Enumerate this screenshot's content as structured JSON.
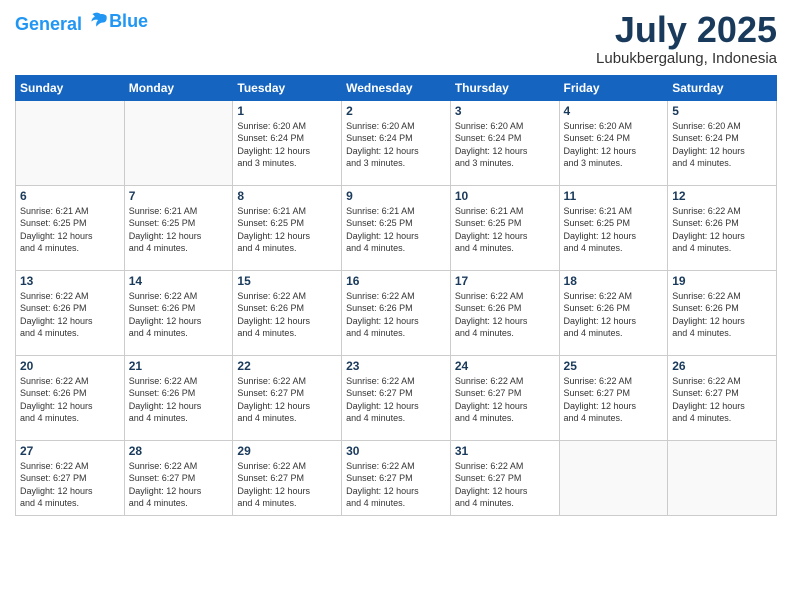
{
  "header": {
    "logo_line1": "General",
    "logo_line2": "Blue",
    "month": "July 2025",
    "location": "Lubukbergalung, Indonesia"
  },
  "weekdays": [
    "Sunday",
    "Monday",
    "Tuesday",
    "Wednesday",
    "Thursday",
    "Friday",
    "Saturday"
  ],
  "weeks": [
    [
      {
        "day": "",
        "info": ""
      },
      {
        "day": "",
        "info": ""
      },
      {
        "day": "1",
        "info": "Sunrise: 6:20 AM\nSunset: 6:24 PM\nDaylight: 12 hours\nand 3 minutes."
      },
      {
        "day": "2",
        "info": "Sunrise: 6:20 AM\nSunset: 6:24 PM\nDaylight: 12 hours\nand 3 minutes."
      },
      {
        "day": "3",
        "info": "Sunrise: 6:20 AM\nSunset: 6:24 PM\nDaylight: 12 hours\nand 3 minutes."
      },
      {
        "day": "4",
        "info": "Sunrise: 6:20 AM\nSunset: 6:24 PM\nDaylight: 12 hours\nand 3 minutes."
      },
      {
        "day": "5",
        "info": "Sunrise: 6:20 AM\nSunset: 6:24 PM\nDaylight: 12 hours\nand 4 minutes."
      }
    ],
    [
      {
        "day": "6",
        "info": "Sunrise: 6:21 AM\nSunset: 6:25 PM\nDaylight: 12 hours\nand 4 minutes."
      },
      {
        "day": "7",
        "info": "Sunrise: 6:21 AM\nSunset: 6:25 PM\nDaylight: 12 hours\nand 4 minutes."
      },
      {
        "day": "8",
        "info": "Sunrise: 6:21 AM\nSunset: 6:25 PM\nDaylight: 12 hours\nand 4 minutes."
      },
      {
        "day": "9",
        "info": "Sunrise: 6:21 AM\nSunset: 6:25 PM\nDaylight: 12 hours\nand 4 minutes."
      },
      {
        "day": "10",
        "info": "Sunrise: 6:21 AM\nSunset: 6:25 PM\nDaylight: 12 hours\nand 4 minutes."
      },
      {
        "day": "11",
        "info": "Sunrise: 6:21 AM\nSunset: 6:25 PM\nDaylight: 12 hours\nand 4 minutes."
      },
      {
        "day": "12",
        "info": "Sunrise: 6:22 AM\nSunset: 6:26 PM\nDaylight: 12 hours\nand 4 minutes."
      }
    ],
    [
      {
        "day": "13",
        "info": "Sunrise: 6:22 AM\nSunset: 6:26 PM\nDaylight: 12 hours\nand 4 minutes."
      },
      {
        "day": "14",
        "info": "Sunrise: 6:22 AM\nSunset: 6:26 PM\nDaylight: 12 hours\nand 4 minutes."
      },
      {
        "day": "15",
        "info": "Sunrise: 6:22 AM\nSunset: 6:26 PM\nDaylight: 12 hours\nand 4 minutes."
      },
      {
        "day": "16",
        "info": "Sunrise: 6:22 AM\nSunset: 6:26 PM\nDaylight: 12 hours\nand 4 minutes."
      },
      {
        "day": "17",
        "info": "Sunrise: 6:22 AM\nSunset: 6:26 PM\nDaylight: 12 hours\nand 4 minutes."
      },
      {
        "day": "18",
        "info": "Sunrise: 6:22 AM\nSunset: 6:26 PM\nDaylight: 12 hours\nand 4 minutes."
      },
      {
        "day": "19",
        "info": "Sunrise: 6:22 AM\nSunset: 6:26 PM\nDaylight: 12 hours\nand 4 minutes."
      }
    ],
    [
      {
        "day": "20",
        "info": "Sunrise: 6:22 AM\nSunset: 6:26 PM\nDaylight: 12 hours\nand 4 minutes."
      },
      {
        "day": "21",
        "info": "Sunrise: 6:22 AM\nSunset: 6:26 PM\nDaylight: 12 hours\nand 4 minutes."
      },
      {
        "day": "22",
        "info": "Sunrise: 6:22 AM\nSunset: 6:27 PM\nDaylight: 12 hours\nand 4 minutes."
      },
      {
        "day": "23",
        "info": "Sunrise: 6:22 AM\nSunset: 6:27 PM\nDaylight: 12 hours\nand 4 minutes."
      },
      {
        "day": "24",
        "info": "Sunrise: 6:22 AM\nSunset: 6:27 PM\nDaylight: 12 hours\nand 4 minutes."
      },
      {
        "day": "25",
        "info": "Sunrise: 6:22 AM\nSunset: 6:27 PM\nDaylight: 12 hours\nand 4 minutes."
      },
      {
        "day": "26",
        "info": "Sunrise: 6:22 AM\nSunset: 6:27 PM\nDaylight: 12 hours\nand 4 minutes."
      }
    ],
    [
      {
        "day": "27",
        "info": "Sunrise: 6:22 AM\nSunset: 6:27 PM\nDaylight: 12 hours\nand 4 minutes."
      },
      {
        "day": "28",
        "info": "Sunrise: 6:22 AM\nSunset: 6:27 PM\nDaylight: 12 hours\nand 4 minutes."
      },
      {
        "day": "29",
        "info": "Sunrise: 6:22 AM\nSunset: 6:27 PM\nDaylight: 12 hours\nand 4 minutes."
      },
      {
        "day": "30",
        "info": "Sunrise: 6:22 AM\nSunset: 6:27 PM\nDaylight: 12 hours\nand 4 minutes."
      },
      {
        "day": "31",
        "info": "Sunrise: 6:22 AM\nSunset: 6:27 PM\nDaylight: 12 hours\nand 4 minutes."
      },
      {
        "day": "",
        "info": ""
      },
      {
        "day": "",
        "info": ""
      }
    ]
  ]
}
